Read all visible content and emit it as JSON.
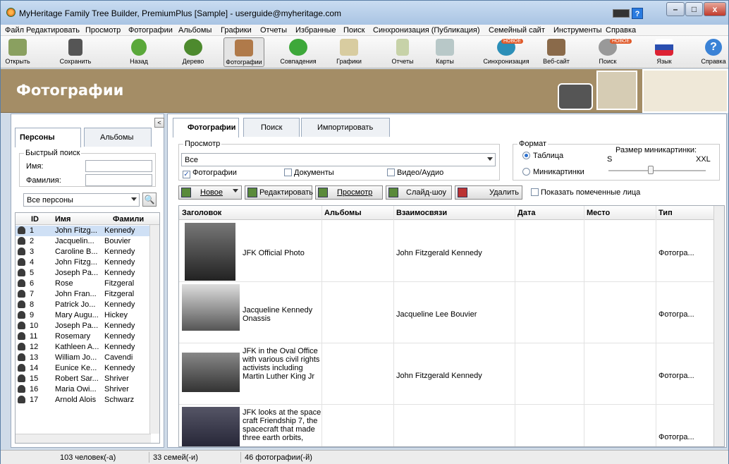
{
  "window": {
    "title": "MyHeritage Family Tree Builder, PremiumPlus [Sample] - userguide@myheritage.com",
    "help": "?",
    "minimize": "–",
    "maximize": "□",
    "close": "x"
  },
  "menu": [
    "Файл",
    "Редактировать",
    "Просмотр",
    "Фотографии",
    "Альбомы",
    "Графики",
    "Отчеты",
    "Избранные",
    "Поиск",
    "Синхронизация (Публикация)",
    "Семейный сайт",
    "Инструменты",
    "Справка"
  ],
  "toolbar": {
    "items": [
      {
        "label": "Открыть",
        "icon": "folder-icon"
      },
      {
        "label": "Сохранить",
        "icon": "save-icon"
      },
      {
        "label": "Назад",
        "icon": "back-arrow-icon"
      },
      {
        "label": "Дерево",
        "icon": "tree-icon"
      },
      {
        "label": "Фотографии",
        "icon": "photos-icon"
      },
      {
        "label": "Совпадения",
        "icon": "matches-icon"
      },
      {
        "label": "Графики",
        "icon": "charts-icon"
      },
      {
        "label": "Отчеты",
        "icon": "reports-icon"
      },
      {
        "label": "Карты",
        "icon": "maps-icon"
      },
      {
        "label": "Синхронизация",
        "icon": "sync-icon"
      },
      {
        "label": "Веб-сайт",
        "icon": "website-icon"
      },
      {
        "label": "Поиск",
        "icon": "search-icon"
      },
      {
        "label": "Язык",
        "icon": "language-flag-icon"
      },
      {
        "label": "Справка",
        "icon": "help-icon"
      }
    ],
    "badge": "НОВОЕ",
    "help_glyph": "?"
  },
  "banner": {
    "title": "Фотографии"
  },
  "left": {
    "tabs": [
      "Персоны",
      "Альбомы"
    ],
    "collapse_glyph": "<",
    "quick_search": "Быстрый поиск",
    "first_name_label": "Имя:",
    "last_name_label": "Фамилия:",
    "filter": "Все персоны",
    "columns": [
      "ID",
      "Имя",
      "Фамили"
    ],
    "rows": [
      [
        "1",
        "John Fitzg...",
        "Kennedy"
      ],
      [
        "2",
        "Jacquelin...",
        "Bouvier"
      ],
      [
        "3",
        "Caroline B...",
        "Kennedy"
      ],
      [
        "4",
        "John Fitzg...",
        "Kennedy"
      ],
      [
        "5",
        "Joseph Pa...",
        "Kennedy"
      ],
      [
        "6",
        "Rose",
        "Fitzgeral"
      ],
      [
        "7",
        "John Fran...",
        "Fitzgeral"
      ],
      [
        "8",
        "Patrick Jo...",
        "Kennedy"
      ],
      [
        "9",
        "Mary Augu...",
        "Hickey"
      ],
      [
        "10",
        "Joseph Pa...",
        "Kennedy"
      ],
      [
        "11",
        "Rosemary",
        "Kennedy"
      ],
      [
        "12",
        "Kathleen A...",
        "Kennedy"
      ],
      [
        "13",
        "William Jo...",
        "Cavendi"
      ],
      [
        "14",
        "Eunice Ke...",
        "Kennedy"
      ],
      [
        "15",
        "Robert Sar...",
        "Shriver"
      ],
      [
        "16",
        "Maria Owi...",
        "Shriver"
      ],
      [
        "17",
        "Arnold Alois",
        "Schwarz"
      ]
    ]
  },
  "right": {
    "tabs": [
      "Фотографии",
      "Поиск",
      "Импортировать"
    ],
    "view_group": "Просмотр",
    "view_value": "Все",
    "checks": [
      {
        "label": "Фотографии",
        "checked": true
      },
      {
        "label": "Документы",
        "checked": false
      },
      {
        "label": "Видео/Аудио",
        "checked": false
      }
    ],
    "format_group": "Формат",
    "format_options": [
      {
        "label": "Таблица",
        "selected": true
      },
      {
        "label": "Миникартинки",
        "selected": false
      }
    ],
    "thumb_size_label": "Размер миникартинки:",
    "thumb_min": "S",
    "thumb_max": "XXL",
    "actions": {
      "new": "Новое",
      "edit": "Редактировать",
      "view": "Просмотр",
      "slideshow": "Слайд-шоу",
      "delete": "Удалить",
      "show_tagged": "Показать помеченные лица"
    },
    "columns": [
      "Заголовок",
      "Альбомы",
      "Взаимосвязи",
      "Дата",
      "Место",
      "Тип"
    ],
    "rows": [
      {
        "title": "JFK Official Photo",
        "relations": "John Fitzgerald Kennedy",
        "type": "Фотогра..."
      },
      {
        "title": "Jacqueline Kennedy Onassis",
        "relations": "Jacqueline Lee Bouvier",
        "type": "Фотогра..."
      },
      {
        "title": "JFK in the Oval Office with various civil rights activists including Martin Luther King Jr",
        "relations": "John Fitzgerald Kennedy",
        "type": "Фотогра..."
      },
      {
        "title": "JFK looks at the space craft Friendship 7, the spacecraft that made three earth orbits,",
        "relations": "",
        "type": "Фотогра..."
      }
    ]
  },
  "status": {
    "people": "103 человек(-а)",
    "families": "33 семей(-и)",
    "photos": "46 фотографии(-й)"
  }
}
